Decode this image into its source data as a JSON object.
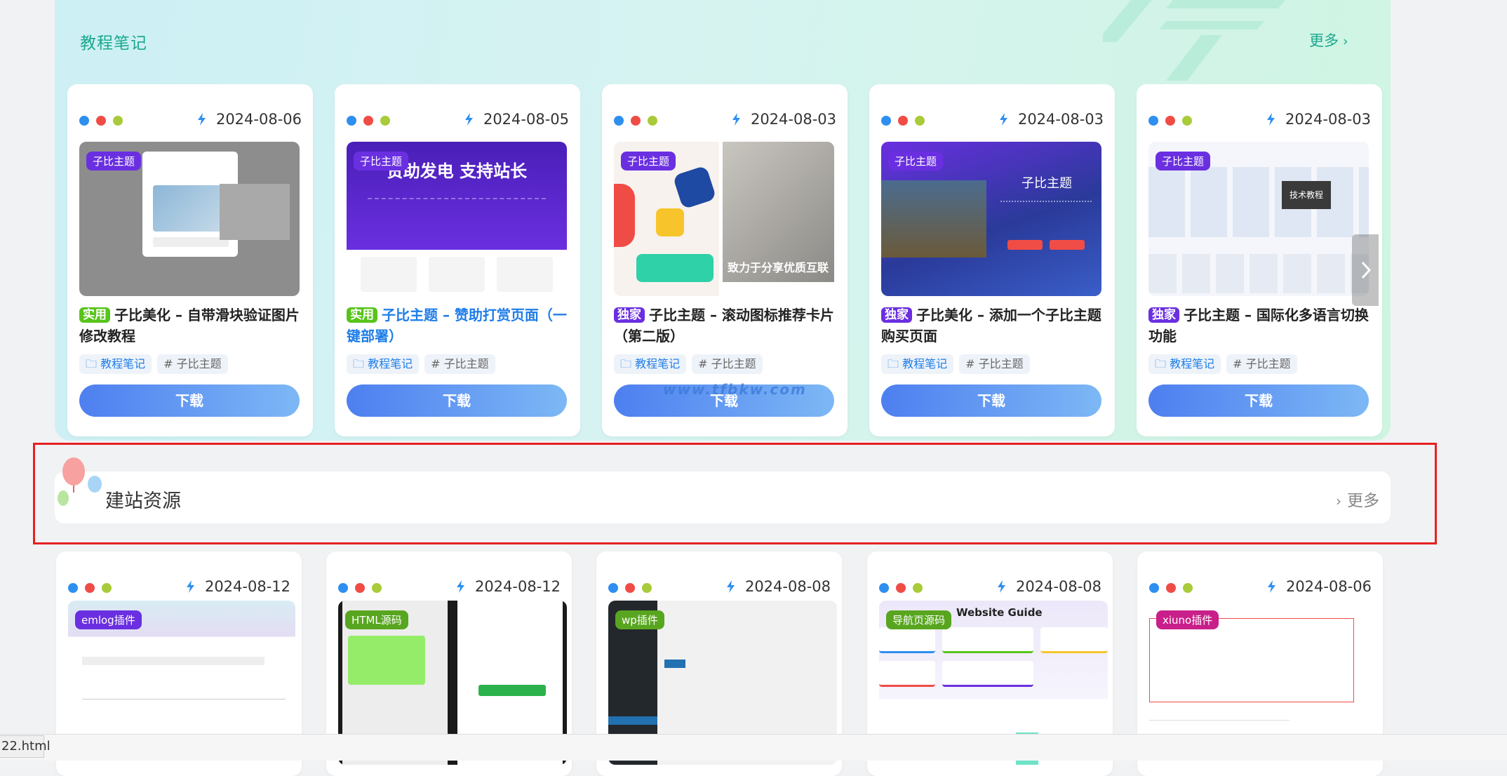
{
  "section1": {
    "title": "教程笔记",
    "more": "更多",
    "cards": [
      {
        "date": "2024-08-06",
        "thumb_tag": "子比主题",
        "badge": "实用",
        "title": "子比美化 – 自带滑块验证图片修改教程",
        "category": "教程笔记",
        "tag": "# 子比主题",
        "download": "下载"
      },
      {
        "date": "2024-08-05",
        "thumb_tag": "子比主题",
        "badge": "实用",
        "title": "子比主题 – 赞助打赏页面（一键部署）",
        "category": "教程笔记",
        "tag": "# 子比主题",
        "download": "下载",
        "thumb_text": "赞助发电 支持站长"
      },
      {
        "date": "2024-08-03",
        "thumb_tag": "子比主题",
        "badge": "独家",
        "title": "子比主题 – 滚动图标推荐卡片（第二版）",
        "category": "教程笔记",
        "tag": "# 子比主题",
        "download": "下载",
        "thumb_text": "致力于分享优质互联"
      },
      {
        "date": "2024-08-03",
        "thumb_tag": "子比主题",
        "badge": "独家",
        "title": "子比美化 – 添加一个子比主题购买页面",
        "category": "教程笔记",
        "tag": "# 子比主题",
        "download": "下载",
        "thumb_text": "子比主题"
      },
      {
        "date": "2024-08-03",
        "thumb_tag": "子比主题",
        "badge": "独家",
        "title": "子比主题 – 国际化多语言切换功能",
        "category": "教程笔记",
        "tag": "# 子比主题",
        "download": "下载",
        "thumb_text": "技术教程"
      }
    ]
  },
  "section2": {
    "title": "建站资源",
    "more": "更多",
    "cards": [
      {
        "date": "2024-08-12",
        "thumb_tag": "emlog插件"
      },
      {
        "date": "2024-08-12",
        "thumb_tag": "HTML源码"
      },
      {
        "date": "2024-08-08",
        "thumb_tag": "wp插件"
      },
      {
        "date": "2024-08-08",
        "thumb_tag": "导航页源码",
        "thumb_text": "Website Guide"
      },
      {
        "date": "2024-08-06",
        "thumb_tag": "xiuno插件"
      }
    ]
  },
  "watermark": "www.tfbkw.com",
  "status_url": "22.html",
  "colors": {
    "accent": "#1aa88e",
    "link": "#1e7de8",
    "badge_green": "#58c41b",
    "badge_purple": "#6a2fe0",
    "frame": "#e52121"
  }
}
